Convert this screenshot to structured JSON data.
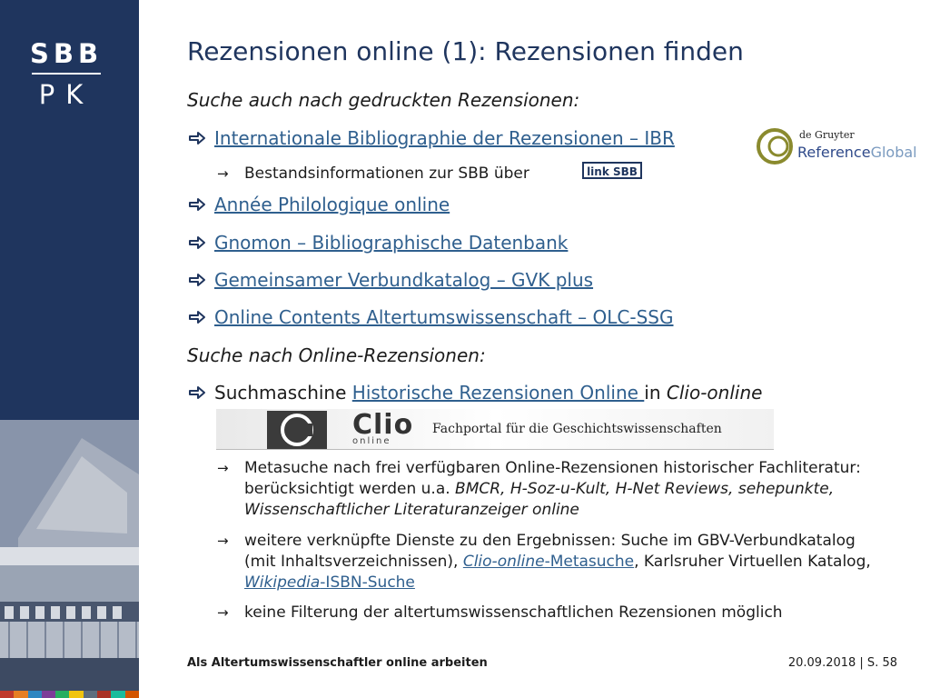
{
  "logo": {
    "top": "SBB",
    "bottom": "PK"
  },
  "title": "Rezensionen online (1): Rezensionen finden",
  "section1": "Suche auch nach gedruckten Rezensionen:",
  "items1": [
    {
      "label": "Internationale Bibliographie der Rezensionen – IBR"
    },
    {
      "label": "Année Philologique online"
    },
    {
      "label": "Gnomon – Bibliographische Datenbank"
    },
    {
      "label": "Gemeinsamer Verbundkatalog – GVK plus"
    },
    {
      "label": "Online Contents Altertumswissenschaft – OLC-SSG"
    }
  ],
  "ibr_sub": "Bestandsinformationen zur SBB über",
  "link_sbb_badge": "link SBB",
  "degruyter": {
    "small": "de Gruyter",
    "reference": "Reference",
    "global": "Global"
  },
  "section2": "Suche nach Online-Rezensionen:",
  "item2": {
    "prefix": "Suchmaschine ",
    "link": "Historische Rezensionen Online ",
    "mid": "in ",
    "em": "Clio-online"
  },
  "clio_banner": {
    "word": "Clio",
    "sub": "online",
    "portal": "Fachportal für die Geschichtswissenschaften"
  },
  "sub1": {
    "plain": "Metasuche nach frei verfügbaren Online-Rezensionen historischer Fachliteratur: berücksichtigt werden u.a. ",
    "em": "BMCR, H-Soz-u-Kult, H-Net Reviews, sehepunkte, Wissenschaftlicher Literaturanzeiger online"
  },
  "sub2": {
    "part1": "weitere verknüpfte Dienste zu den Ergebnissen: Suche im GBV-Verbundkatalog (mit Inhaltsverzeichnissen), ",
    "link1_em": "Clio-online",
    "link1_rest": "-Metasuche",
    "part2": ", Karlsruher Virtuellen Katalog, ",
    "link2_em": "Wikipedia",
    "link2_rest": "-ISBN-Suche"
  },
  "sub3": "keine Filterung der altertumswissenschaftlichen Rezensionen möglich",
  "footer": {
    "left": "Als Altertumswissenschaftler online arbeiten",
    "right": "20.09.2018 | S. 58"
  },
  "colors": {
    "band": "#1f355e",
    "link": "#2f5f8e",
    "title": "#1f355e"
  }
}
